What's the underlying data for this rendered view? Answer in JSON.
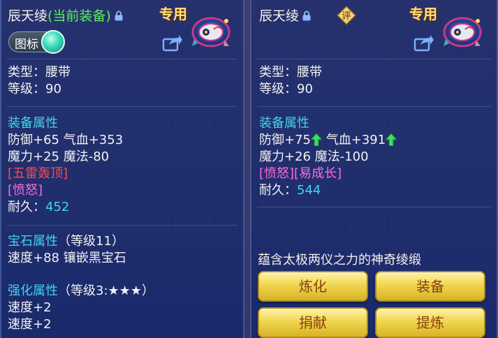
{
  "left": {
    "title_name": "辰天绫",
    "title_status": "(当前装备)",
    "zhuanyong": "专用",
    "toggle_label": "图标",
    "type_line": "类型：腰带",
    "level_line": "等级：90",
    "equip_attr_header": "装备属性",
    "stats_line1": "防御+65 气血+353",
    "stats_line2": "魔力+25 魔法-80",
    "special1": "[五雷轰顶]",
    "special2": "[愤怒]",
    "durability_label": "耐久：",
    "durability_value": "452",
    "gem_header": "宝石属性",
    "gem_level": "（等级11）",
    "gem_line": "速度+88 镶嵌黑宝石",
    "enhance_header": "强化属性",
    "enhance_level": "（等级3:★★★）",
    "enhance_line1": "速度+2",
    "enhance_line2": "速度+2"
  },
  "right": {
    "title_name": "辰天绫",
    "ping": "评",
    "zhuanyong": "专用",
    "type_line": "类型：腰带",
    "level_line": "等级：90",
    "equip_attr_header": "装备属性",
    "def": "防御+75",
    "hp": "气血+391",
    "stats_line2": "魔力+26 魔法-100",
    "special": "[愤怒][易成长]",
    "durability_label": "耐久：",
    "durability_value": "544",
    "description": "蕴含太极两仪之力的神奇绫缎",
    "buttons": [
      "炼化",
      "装备",
      "捐献",
      "提炼"
    ]
  },
  "colors": {
    "current_equip": "#5cf05c",
    "section_header": "#3fd4f0",
    "red_special": "#ff4a4a",
    "pink_special": "#ff6ad8",
    "button_text": "#8a3e10"
  }
}
